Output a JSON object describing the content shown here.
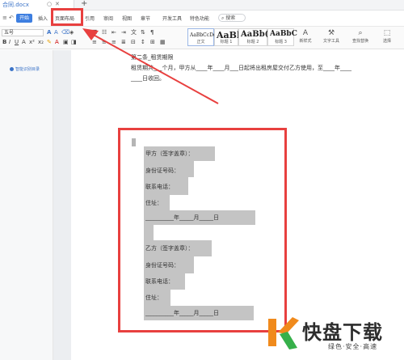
{
  "tabbar": {
    "doc_name": "合同.docx",
    "new_tab": "+"
  },
  "menubar": {
    "start": "开始",
    "items": [
      "插入",
      "页面布局",
      "引用",
      "审阅",
      "视图",
      "章节",
      "开发工具",
      "特色功能"
    ],
    "search": "搜索"
  },
  "toolbar": {
    "font_size": "五号",
    "styles": [
      {
        "sample": "AaBbCcDd",
        "caption": "正文"
      },
      {
        "sample": "AaBl",
        "caption": "标题 1"
      },
      {
        "sample": "AaBb(",
        "caption": "标题 2"
      },
      {
        "sample": "AaBbC",
        "caption": "标题 3"
      }
    ],
    "tools": [
      {
        "icon": "new-style-icon",
        "label": "新样式"
      },
      {
        "icon": "text-tools-icon",
        "label": "文字工具"
      },
      {
        "icon": "find-replace-icon",
        "label": "查找替换"
      },
      {
        "icon": "select-icon",
        "label": "选择"
      }
    ]
  },
  "left_panel": {
    "nav_label": "智能识别目录"
  },
  "document": {
    "clause_title": "第二条_租赁期限",
    "clause_line1": "租赁期共___个月，甲方从____年____月___日起将出租房屋交付乙方使用，至____年____",
    "clause_line2": "____日收回。",
    "party_a": {
      "title": "甲方（签字盖章）：",
      "id": "身份证号码：",
      "phone": "联系电话：",
      "address": "住址：",
      "date": "__________年_____月_____日"
    },
    "party_b": {
      "title": "乙方（签字盖章）：",
      "id": "身份证号码：",
      "phone": "联系电话：",
      "address": "住址：",
      "date": "__________年_____月_____日"
    }
  },
  "watermark": {
    "brand": "快盘下载",
    "slogan": "绿色·安全·高速"
  },
  "colors": {
    "accent_blue": "#3d7ee0",
    "annotation_red": "#e8403f",
    "highlight_gray": "#c4c4c4",
    "logo_orange": "#f08a1c",
    "logo_green": "#36b04a"
  }
}
